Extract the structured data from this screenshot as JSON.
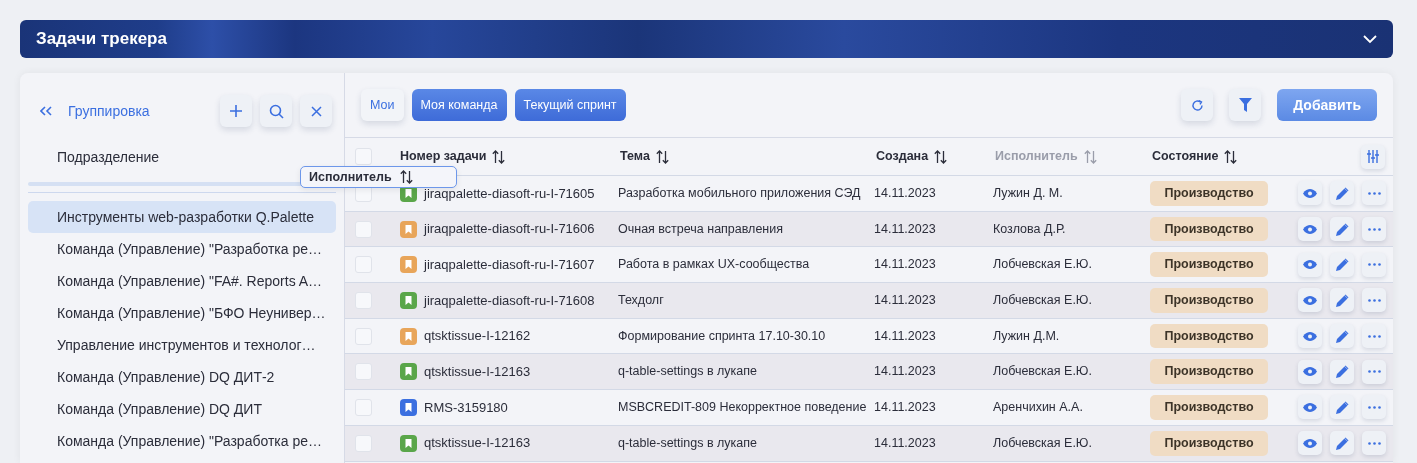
{
  "header": {
    "title": "Задачи трекера"
  },
  "sidebar": {
    "title": "Группировка",
    "field_label": "Подразделение",
    "items": [
      {
        "label": "Инструменты web-разработки Q.Palette",
        "selected": true
      },
      {
        "label": "Команда (Управление) \"Разработка ре…",
        "selected": false
      },
      {
        "label": "Команда (Управление) \"FA#. Reports A…",
        "selected": false
      },
      {
        "label": "Команда (Управление) \"БФО Неунивер…",
        "selected": false
      },
      {
        "label": "Управление инструментов и технолог…",
        "selected": false
      },
      {
        "label": "Команда (Управление) DQ ДИТ-2",
        "selected": false
      },
      {
        "label": "Команда (Управление) DQ ДИТ",
        "selected": false
      },
      {
        "label": "Команда (Управление) \"Разработка ре…",
        "selected": false
      }
    ]
  },
  "toolbar": {
    "filters": [
      {
        "label": "Мои",
        "selected": false
      },
      {
        "label": "Моя команда",
        "selected": true
      },
      {
        "label": "Текущий спринт",
        "selected": true
      }
    ],
    "add_button": "Добавить"
  },
  "table": {
    "select_all_checked": false,
    "columns": [
      {
        "label": "Номер задачи",
        "dimmed": false
      },
      {
        "label": "Тема",
        "dimmed": false
      },
      {
        "label": "Создана",
        "dimmed": false
      },
      {
        "label": "Исполнитель",
        "dimmed": true
      },
      {
        "label": "Состояние",
        "dimmed": false
      }
    ],
    "rows": [
      {
        "checked": false,
        "color": "#5aa64a",
        "id": "jiraqpalette-diasoft-ru-I-71605",
        "topic": "Разработка мобильного приложения СЭД",
        "created": "14.11.2023",
        "assignee": "Лужин Д. М.",
        "status": "Производство"
      },
      {
        "checked": false,
        "color": "#e8a55a",
        "id": "jiraqpalette-diasoft-ru-I-71606",
        "topic": "Очная встреча направления",
        "created": "14.11.2023",
        "assignee": "Козлова Д.Р.",
        "status": "Производство"
      },
      {
        "checked": false,
        "color": "#e8a55a",
        "id": "jiraqpalette-diasoft-ru-I-71607",
        "topic": "Работа в рамках UX-сообщества",
        "created": "14.11.2023",
        "assignee": "Лобчевская Е.Ю.",
        "status": "Производство"
      },
      {
        "checked": false,
        "color": "#5aa64a",
        "id": "jiraqpalette-diasoft-ru-I-71608",
        "topic": "Техдолг",
        "created": "14.11.2023",
        "assignee": "Лобчевская Е.Ю.",
        "status": "Производство"
      },
      {
        "checked": false,
        "color": "#e8a55a",
        "id": "qtsktissue-I-12162",
        "topic": "Формирование спринта 17.10-30.10",
        "created": "14.11.2023",
        "assignee": "Лужин Д.М.",
        "status": "Производство"
      },
      {
        "checked": false,
        "color": "#5aa64a",
        "id": "qtsktissue-I-12163",
        "topic": "q-table-settings в лукапе",
        "created": "14.11.2023",
        "assignee": "Лобчевская Е.Ю.",
        "status": "Производство"
      },
      {
        "checked": false,
        "color": "#3b6fe0",
        "id": "RMS-3159180",
        "topic": "MSBCREDIT-809 Некорректное поведение",
        "created": "14.11.2023",
        "assignee": "Аренчихин А.А.",
        "status": "Производство"
      },
      {
        "checked": false,
        "color": "#5aa64a",
        "id": "qtsktissue-I-12163",
        "topic": "q-table-settings в лукапе",
        "created": "14.11.2023",
        "assignee": "Лобчевская Е.Ю.",
        "status": "Производство"
      }
    ]
  },
  "drag_overlay": {
    "label": "Исполнитель"
  }
}
